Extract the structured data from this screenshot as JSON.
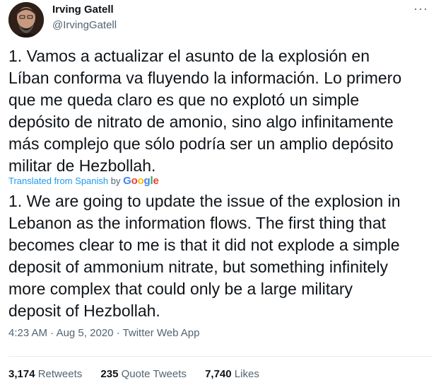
{
  "tweet": {
    "author": {
      "name": "Irving Gatell",
      "handle": "@IrvingGatell"
    },
    "more_label": "···",
    "original_text": "1. Vamos a actualizar el asunto de la explosión en\nLíban conforma va fluyendo la información. Lo primero\nque me queda claro es que no explotó un simple\ndepósito de nitrato de amonio, sino algo infinitamente\nmás complejo que sólo podría ser un amplio depósito\nmilitar de Hezbollah.",
    "translation_label": "Translated from Spanish",
    "translation_by": "by",
    "translation_provider": "Google",
    "translated_text": "1. We are going to update the issue of the explosion in\nLebanon as the information flows. The first thing that\nbecomes clear to me is that it did not explode a simple\ndeposit of ammonium nitrate, but something infinitely\nmore complex that could only be a large military\ndeposit of Hezbollah.",
    "time": "4:23 AM",
    "date": "Aug 5, 2020",
    "source": "Twitter Web App",
    "separator": "·",
    "stats": {
      "retweets_count": "3,174",
      "retweets_label": "Retweets",
      "quotes_count": "235",
      "quotes_label": "Quote Tweets",
      "likes_count": "7,740",
      "likes_label": "Likes"
    }
  },
  "colors": {
    "link": "#1d9bf0",
    "secondary": "#536471",
    "primary": "#0f1419",
    "divider": "#e6ecf0"
  }
}
